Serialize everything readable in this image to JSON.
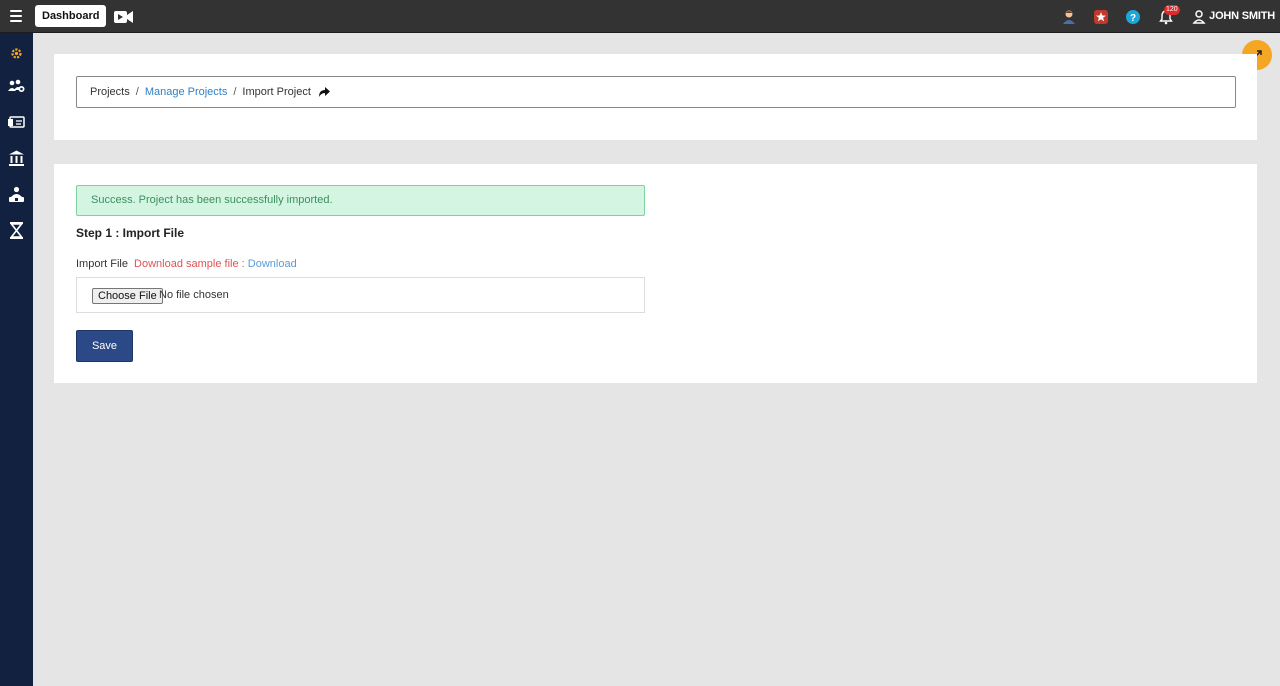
{
  "topbar": {
    "dashboard_label": "Dashboard",
    "notification_count": "120",
    "user_name": "JOHN SMITH"
  },
  "breadcrumb": {
    "item1": "Projects",
    "item2": "Manage Projects",
    "item3": "Import Project",
    "separator": "/"
  },
  "alert": {
    "text": "Success. Project has been successfully imported."
  },
  "form": {
    "step_title": "Step 1 : Import File",
    "import_label": "Import File",
    "sample_text": "Download sample file :",
    "download_link": "Download",
    "choose_button": "Choose File",
    "file_status": "No file chosen",
    "save_button": "Save"
  },
  "colors": {
    "topbar": "#333333",
    "sidebar": "#12213f",
    "accent_orange": "#f5a623",
    "save_button": "#2b4887",
    "alert_bg": "#d4f5e2"
  },
  "icons": {
    "sidebar": [
      "settings-icon",
      "users-icon",
      "id-card-icon",
      "bank-icon",
      "worker-icon",
      "hourglass-icon"
    ],
    "topbar": [
      "menu-icon",
      "video-icon",
      "profile-icon",
      "star-badge-icon",
      "help-icon",
      "bell-icon",
      "user-icon"
    ]
  }
}
